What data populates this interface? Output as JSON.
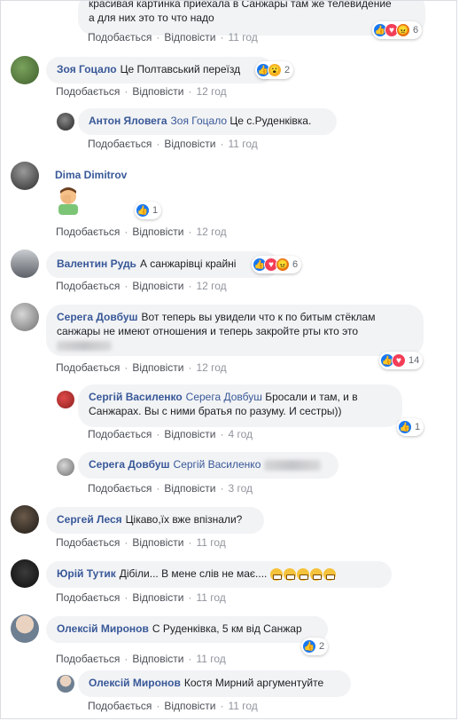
{
  "labels": {
    "like": "Подобається",
    "reply": "Відповісти",
    "dot": "·"
  },
  "colors": {
    "link": "#385898",
    "bubble": "#f2f3f5",
    "like": "#1877f2",
    "love": "#f33e58",
    "angry": "#e9710f",
    "wow": "#f7b125"
  },
  "comments": [
    {
      "text_line1": "красивая картинка приехала в Санжары там же телевидение",
      "text_line2": "а для них это то что надо",
      "time": "11 год",
      "reactions": [
        "like",
        "love",
        "angry"
      ],
      "count": "6"
    },
    {
      "name": "Зоя Гоцало",
      "text": "Це Полтавський переїзд",
      "time": "12 год",
      "reactions": [
        "like",
        "wow"
      ],
      "count": "2"
    },
    {
      "name": "Антон Яловега",
      "mention": "Зоя Гоцало",
      "text": "Це с.Руденківка.",
      "time": "11 год"
    },
    {
      "name": "Dima Dimitrov",
      "sticker": "face-palm-emoji",
      "time": "12 год",
      "reactions": [
        "like"
      ],
      "count": "1"
    },
    {
      "name": "Валентин Рудь",
      "text": "А санжарівці крайні",
      "time": "12 год",
      "reactions": [
        "like",
        "love",
        "angry"
      ],
      "count": "6"
    },
    {
      "name": "Серега Довбуш",
      "text_line1": "Вот теперь вы увидели что к по битым стёклам",
      "text_line2": "санжары не имеют отношения и теперь закройте рты кто это",
      "time": "12 год",
      "reactions": [
        "like",
        "love"
      ],
      "count": "14"
    },
    {
      "name": "Сергій Василенко",
      "mention": "Серега Довбуш",
      "text_line1": "Бросали и там, и в",
      "text_line2": "Санжарах. Вы с ними братья по разуму. И сестры))",
      "time": "4 год",
      "reactions": [
        "like"
      ],
      "count": "1"
    },
    {
      "name": "Серега Довбуш",
      "mention": "Сергій Василенко",
      "time": "3 год"
    },
    {
      "name": "Сергей Леся",
      "text": "Цікаво,їх вже впізнали?",
      "time": "11 год"
    },
    {
      "name": "Юрій Тутик",
      "text": "Дібіли... В мене слів не має....",
      "time": "11 год"
    },
    {
      "name": "Олексій Миронов",
      "text": "С Руденківка, 5 км від Санжар",
      "time": "11 год",
      "reactions": [
        "like"
      ],
      "count": "2"
    },
    {
      "name": "Олексій Миронов",
      "text": "Костя Мирний аргументуйте",
      "time": "11 год"
    }
  ]
}
